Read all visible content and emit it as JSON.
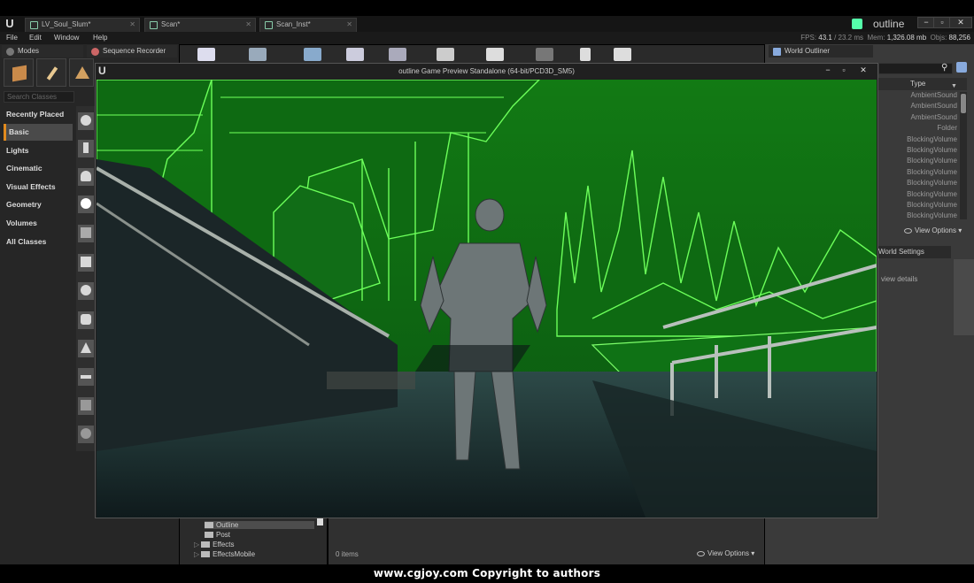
{
  "app": {
    "project_name": "outline",
    "doc_tabs": [
      {
        "label": "LV_Soul_Slum*"
      },
      {
        "label": "Scan*"
      },
      {
        "label": "Scan_Inst*"
      }
    ],
    "window_controls": {
      "minimize": "−",
      "maximize": "▫",
      "close": "✕"
    }
  },
  "menu": {
    "items": [
      "File",
      "Edit",
      "Window",
      "Help"
    ],
    "stats": {
      "fps_label": "FPS:",
      "fps_value": "43.1",
      "frame_time": "23.2 ms",
      "mem_label": "Mem:",
      "mem_value": "1,326.08 mb",
      "objs_label": "Objs:",
      "objs_value": "88,256"
    }
  },
  "modes_panel": {
    "title": "Modes",
    "search_placeholder": "Search Classes",
    "categories": [
      "Recently Placed",
      "Basic",
      "Lights",
      "Cinematic",
      "Visual Effects",
      "Geometry",
      "Volumes",
      "All Classes"
    ],
    "active_category": "Basic"
  },
  "sequence_panel": {
    "title": "Sequence Recorder"
  },
  "world_outliner": {
    "title": "World Outliner",
    "column_type": "Type",
    "rows": [
      "AmbientSound",
      "AmbientSound",
      "AmbientSound",
      "Folder",
      "BlockingVolume",
      "BlockingVolume",
      "BlockingVolume",
      "BlockingVolume",
      "BlockingVolume",
      "BlockingVolume",
      "BlockingVolume",
      "BlockingVolume"
    ],
    "view_options": "View Options"
  },
  "world_settings": {
    "title": "World Settings",
    "body_text": "view details"
  },
  "game_window": {
    "title": "outline Game Preview Standalone (64-bit/PCD3D_SM5)",
    "controls": {
      "minimize": "−",
      "maximize": "▫",
      "close": "✕"
    }
  },
  "content_browser": {
    "tree": [
      "Outline",
      "Post",
      "Effects",
      "EffectsMobile"
    ],
    "selected": "Outline",
    "item_count": "0 items",
    "view_options": "View Options"
  },
  "watermark": "www.cgjoy.com Copyright to authors",
  "colors": {
    "editor_bg": "#3d3d3d",
    "accent_orange": "#e08a1e",
    "outline_green": "#3ee23a"
  }
}
